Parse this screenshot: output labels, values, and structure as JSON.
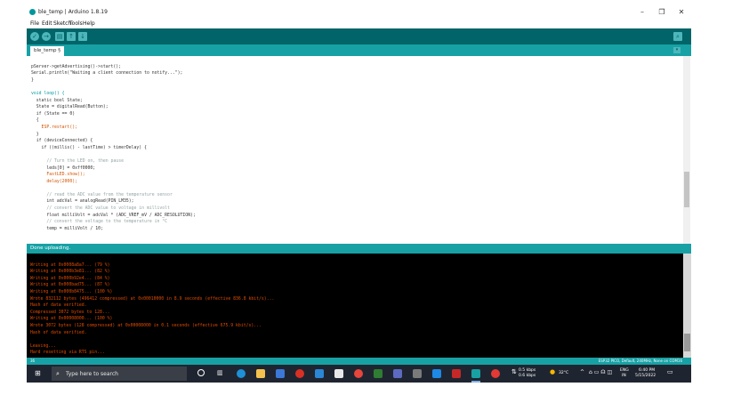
{
  "window": {
    "title": "ble_temp | Arduino 1.8.19",
    "minimize_glyph": "–",
    "maximize_glyph": "❐",
    "close_glyph": "✕"
  },
  "menu": [
    "File",
    "Edit",
    "Sketch",
    "Tools",
    "Help"
  ],
  "toolbar": {
    "verify_icon": "✓",
    "upload_icon": "→",
    "new_icon": "▤",
    "open_icon": "↑",
    "save_icon": "↓",
    "serial_icon": "⌕"
  },
  "tab": {
    "label": "ble_temp §",
    "menu_icon": "▾"
  },
  "code": [
    "pServer->getAdvertising()->start();",
    "Serial.println(\"Waiting a client connection to notify...\");",
    "}",
    "",
    "void loop() {",
    "  static bool State;",
    "  State = digitalRead(Button);",
    "  if (State == 0)",
    "  {",
    "    ESP.restart();",
    "  }",
    "  if (deviceConnected) {",
    "    if ((millis() - lastTime) > timerDelay) {",
    "",
    "      // Turn the LED on, then pause",
    "      leds[0] = 0xff0000;",
    "      FastLED.show();",
    "      delay(2000);",
    "",
    "      // read the ADC value from the temperature sensor",
    "      int adcVal = analogRead(PIN_LM35);",
    "      // convert the ADC value to voltage in millivolt",
    "      float milliVolt = adcVal * (ADC_VREF_mV / ADC_RESOLUTION);",
    "      // convert the voltage to the temperature in °C",
    "      temp = milliVolt / 10;"
  ],
  "status": "Done uploading.",
  "console": [
    "Writing at 0x0008a8a7... (79 %)",
    "Writing at 0x000b3e81... (82 %)",
    "Writing at 0x000b92e4... (84 %)",
    "Writing at 0x000bad75... (87 %)",
    "Writing at 0x000b8475... (100 %)",
    "Wrote 832112 bytes (496412 compressed) at 0x00010000 in 8.9 seconds (effective 836.8 kbit/s)...",
    "Hash of data verified.",
    "Compressed 3072 bytes to 128...",
    "Writing at 0x00008000... (100 %)",
    "Wrote 3072 bytes (128 compressed) at 0x00008000 in 0.1 seconds (effective 675.9 kbit/s)...",
    "Hash of data verified.",
    "",
    "Leaving...",
    "Hard resetting via RTS pin..."
  ],
  "footer": {
    "line": "36",
    "board": "ESP32 PICO, Default, 240MHz, None on COM16"
  },
  "taskbar": {
    "search_placeholder": "Type here to search",
    "network_up": "0.5 kbps",
    "network_down": "0.6 kbps",
    "weather": "32°C",
    "lang_top": "ENG",
    "lang_bottom": "IN",
    "time": "6:40 PM",
    "date": "5/15/2022"
  }
}
